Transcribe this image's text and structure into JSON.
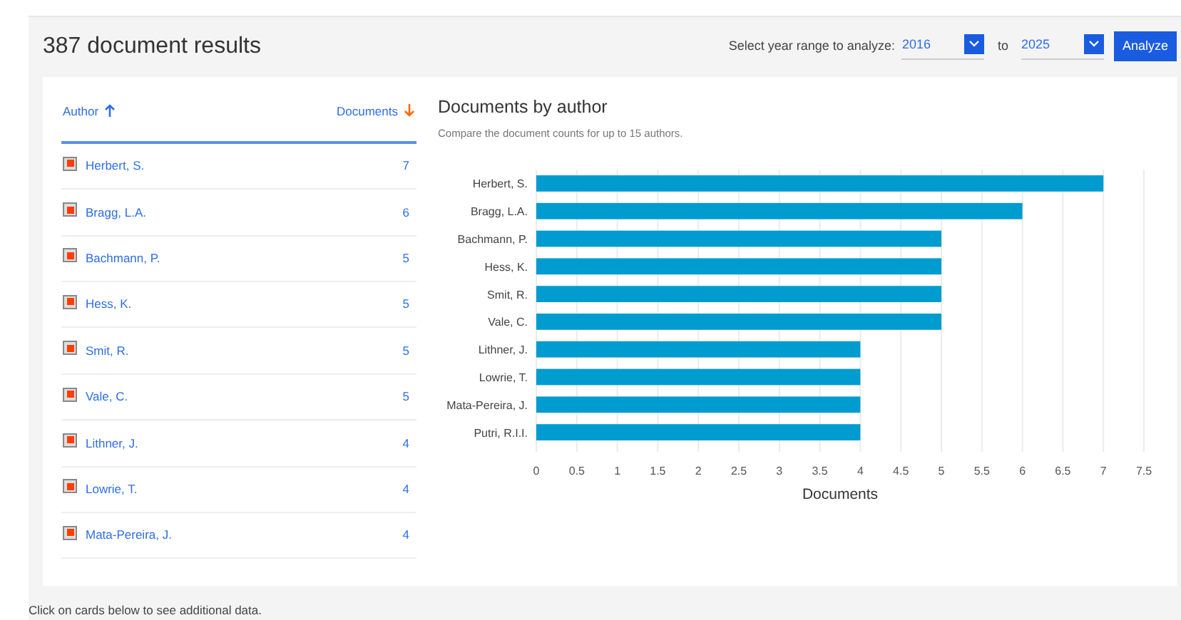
{
  "header": {
    "title": "387 document results",
    "range_label": "Select year range to analyze:",
    "from_year": "2016",
    "to_label": "to",
    "to_year": "2025",
    "analyze_button": "Analyze"
  },
  "table": {
    "columns": [
      {
        "label": "Author",
        "sort_ascending": true
      },
      {
        "label": "Documents",
        "sort_ascending": false
      }
    ],
    "rows": [
      {
        "author": "Herbert, S.",
        "count": "7",
        "checked": true
      },
      {
        "author": "Bragg, L.A.",
        "count": "6",
        "checked": true
      },
      {
        "author": "Bachmann, P.",
        "count": "5",
        "checked": true
      },
      {
        "author": "Hess, K.",
        "count": "5",
        "checked": true
      },
      {
        "author": "Smit, R.",
        "count": "5",
        "checked": true
      },
      {
        "author": "Vale, C.",
        "count": "5",
        "checked": true
      },
      {
        "author": "Lithner, J.",
        "count": "4",
        "checked": true
      },
      {
        "author": "Lowrie, T.",
        "count": "4",
        "checked": true
      },
      {
        "author": "Mata-Pereira, J.",
        "count": "4",
        "checked": true
      }
    ]
  },
  "chart": {
    "title": "Documents by author",
    "subtitle": "Compare the document counts for up to 15 authors.",
    "chart_data": {
      "type": "bar",
      "orientation": "horizontal",
      "xlabel": "Documents",
      "categories": [
        "Herbert, S.",
        "Bragg, L.A.",
        "Bachmann, P.",
        "Hess, K.",
        "Smit, R.",
        "Vale, C.",
        "Lithner, J.",
        "Lowrie, T.",
        "Mata-Pereira, J.",
        "Putri, R.I.I."
      ],
      "grid": true,
      "series": [
        {
          "color": "#009ccf",
          "values": [
            7,
            6,
            5,
            5,
            5,
            5,
            4,
            4,
            4,
            4
          ]
        }
      ],
      "xlim": [
        0,
        7.5
      ],
      "xticks": [
        0,
        0.5,
        1,
        1.5,
        2,
        2.5,
        3,
        3.5,
        4,
        4.5,
        5,
        5.5,
        6,
        6.5,
        7,
        7.5
      ]
    }
  },
  "footer": "Click on cards below to see additional data."
}
